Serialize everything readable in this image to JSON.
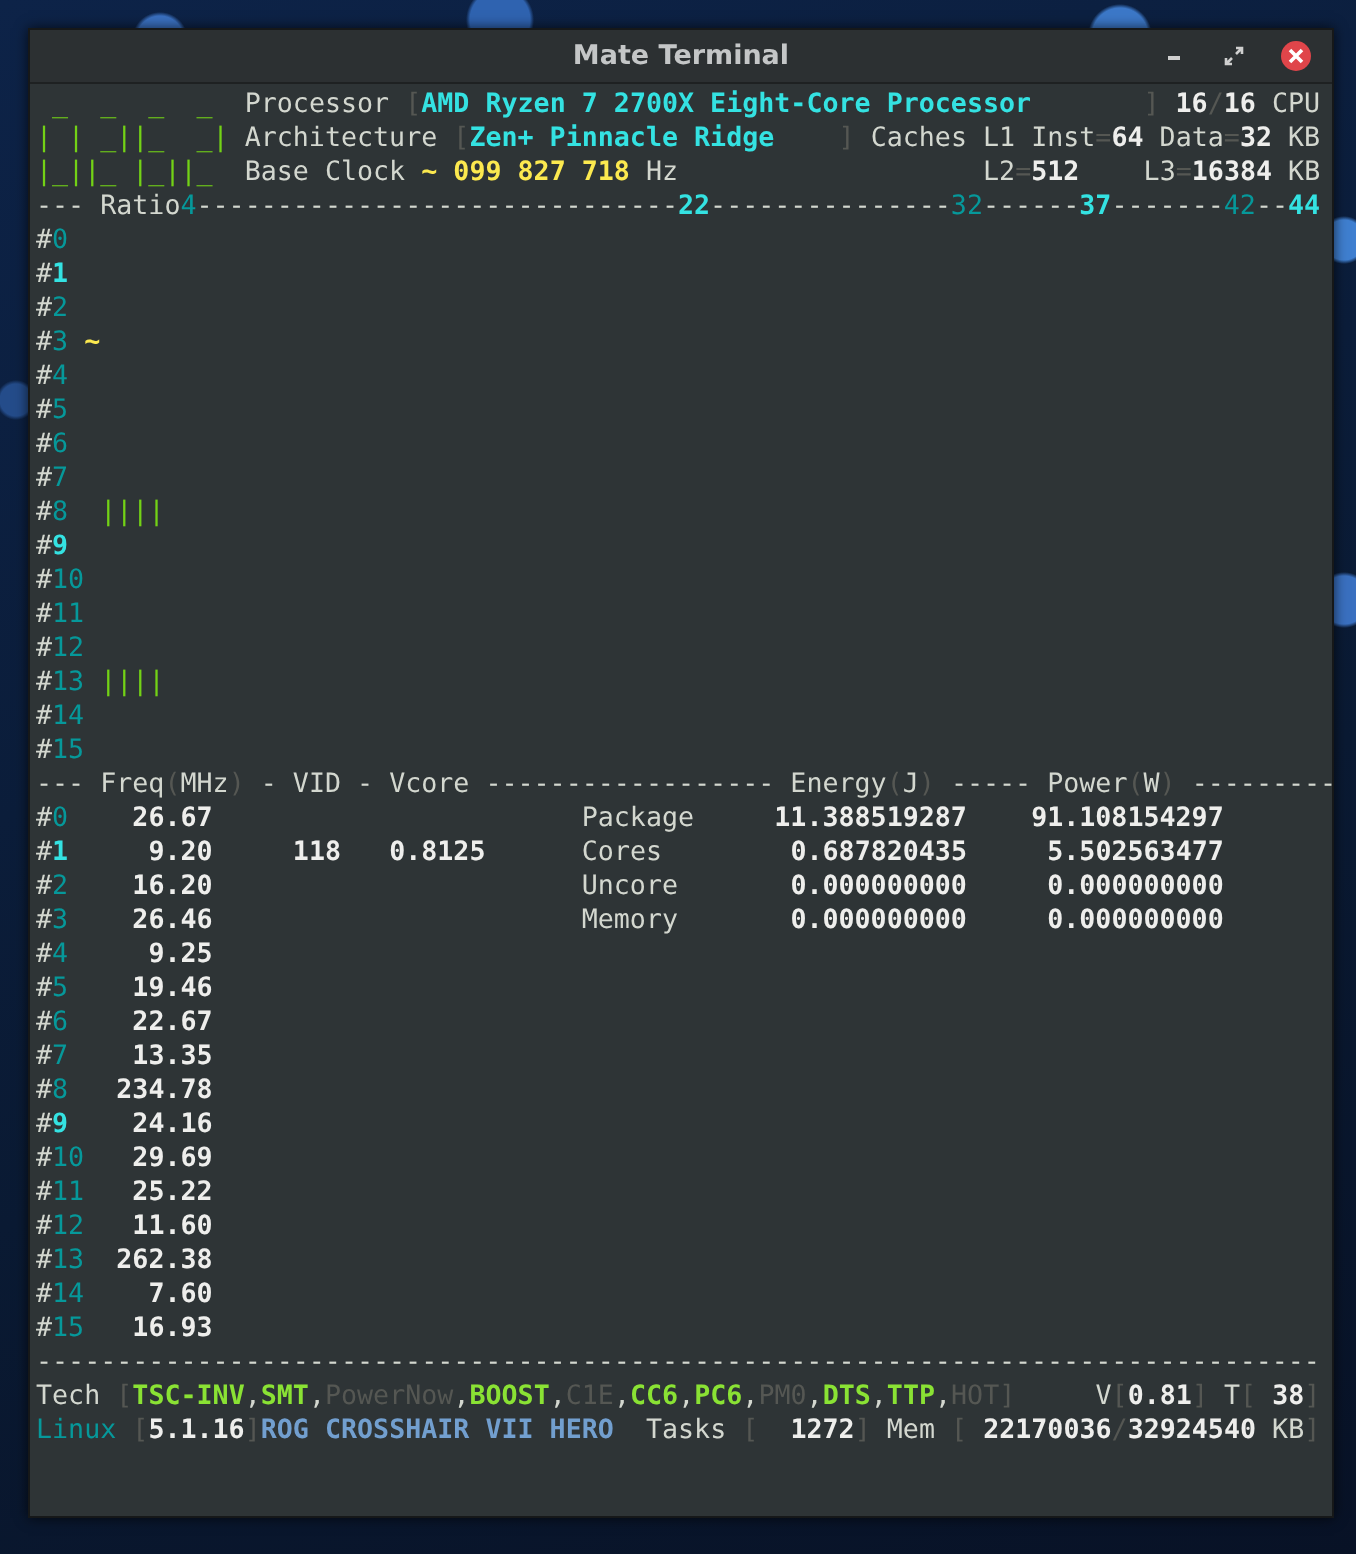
{
  "window": {
    "title": "Mate Terminal"
  },
  "terminal": {
    "lines": [
      {
        "segments": [
          {
            "text": " _  _  _  _  ",
            "kind": "graph"
          },
          {
            "text": "Processor ",
            "kind": "label"
          },
          {
            "text": "[",
            "kind": "muted"
          },
          {
            "text": "AMD Ryzen 7 2700X Eight-Core Processor",
            "kind": "highlight"
          },
          {
            "text": "       ] ",
            "kind": "muted"
          },
          {
            "text": "16",
            "kind": "value"
          },
          {
            "text": "/",
            "kind": "muted"
          },
          {
            "text": "16",
            "kind": "value"
          },
          {
            "text": " CPU",
            "kind": "label"
          }
        ]
      },
      {
        "segments": [
          {
            "text": "| | _||_  _| ",
            "kind": "graph"
          },
          {
            "text": "Architecture ",
            "kind": "label"
          },
          {
            "text": "[",
            "kind": "muted"
          },
          {
            "text": "Zen+ Pinnacle Ridge",
            "kind": "highlight"
          },
          {
            "text": "    ] ",
            "kind": "muted"
          },
          {
            "text": "Caches L1 Inst",
            "kind": "label"
          },
          {
            "text": "=",
            "kind": "muted"
          },
          {
            "text": "64",
            "kind": "value"
          },
          {
            "text": " Data",
            "kind": "label"
          },
          {
            "text": "=",
            "kind": "muted"
          },
          {
            "text": "32",
            "kind": "value"
          },
          {
            "text": " KB",
            "kind": "label"
          }
        ]
      },
      {
        "segments": [
          {
            "text": "|_||_ |_||_  ",
            "kind": "graph"
          },
          {
            "text": "Base Clock ",
            "kind": "label"
          },
          {
            "text": "~ 099 827 718",
            "kind": "clock"
          },
          {
            "text": " Hz",
            "kind": "label"
          },
          {
            "text": "                   L2",
            "kind": "label"
          },
          {
            "text": "=",
            "kind": "muted"
          },
          {
            "text": "512",
            "kind": "value"
          },
          {
            "text": "    L3",
            "kind": "label"
          },
          {
            "text": "=",
            "kind": "muted"
          },
          {
            "text": "16384",
            "kind": "value"
          },
          {
            "text": " KB",
            "kind": "label"
          }
        ]
      },
      {
        "segments": [
          {
            "text": "--- Ratio",
            "kind": "label"
          },
          {
            "text": "4",
            "kind": "index"
          },
          {
            "text": "------------------------------",
            "kind": "label"
          },
          {
            "text": "22",
            "kind": "highlight"
          },
          {
            "text": "---------------",
            "kind": "label"
          },
          {
            "text": "32",
            "kind": "index"
          },
          {
            "text": "------",
            "kind": "label"
          },
          {
            "text": "37",
            "kind": "highlight"
          },
          {
            "text": "-------",
            "kind": "label"
          },
          {
            "text": "42",
            "kind": "index"
          },
          {
            "text": "--",
            "kind": "label"
          },
          {
            "text": "44",
            "kind": "highlight"
          }
        ]
      },
      {
        "segments": [
          {
            "text": "#",
            "kind": "label"
          },
          {
            "text": "0",
            "kind": "index"
          }
        ]
      },
      {
        "segments": [
          {
            "text": "#",
            "kind": "label"
          },
          {
            "text": "1",
            "kind": "highlight"
          }
        ]
      },
      {
        "segments": [
          {
            "text": "#",
            "kind": "label"
          },
          {
            "text": "2",
            "kind": "index"
          }
        ]
      },
      {
        "segments": [
          {
            "text": "#",
            "kind": "label"
          },
          {
            "text": "3",
            "kind": "index"
          },
          {
            "text": " ~",
            "kind": "clock"
          }
        ]
      },
      {
        "segments": [
          {
            "text": "#",
            "kind": "label"
          },
          {
            "text": "4",
            "kind": "index"
          }
        ]
      },
      {
        "segments": [
          {
            "text": "#",
            "kind": "label"
          },
          {
            "text": "5",
            "kind": "index"
          }
        ]
      },
      {
        "segments": [
          {
            "text": "#",
            "kind": "label"
          },
          {
            "text": "6",
            "kind": "index"
          }
        ]
      },
      {
        "segments": [
          {
            "text": "#",
            "kind": "label"
          },
          {
            "text": "7",
            "kind": "index"
          }
        ]
      },
      {
        "segments": [
          {
            "text": "#",
            "kind": "label"
          },
          {
            "text": "8",
            "kind": "index"
          },
          {
            "text": "  ||||",
            "kind": "graph"
          }
        ]
      },
      {
        "segments": [
          {
            "text": "#",
            "kind": "label"
          },
          {
            "text": "9",
            "kind": "highlight"
          }
        ]
      },
      {
        "segments": [
          {
            "text": "#",
            "kind": "label"
          },
          {
            "text": "10",
            "kind": "index"
          }
        ]
      },
      {
        "segments": [
          {
            "text": "#",
            "kind": "label"
          },
          {
            "text": "11",
            "kind": "index"
          }
        ]
      },
      {
        "segments": [
          {
            "text": "#",
            "kind": "label"
          },
          {
            "text": "12",
            "kind": "index"
          }
        ]
      },
      {
        "segments": [
          {
            "text": "#",
            "kind": "label"
          },
          {
            "text": "13",
            "kind": "index"
          },
          {
            "text": " ||||",
            "kind": "graph"
          }
        ]
      },
      {
        "segments": [
          {
            "text": "#",
            "kind": "label"
          },
          {
            "text": "14",
            "kind": "index"
          }
        ]
      },
      {
        "segments": [
          {
            "text": "#",
            "kind": "label"
          },
          {
            "text": "15",
            "kind": "index"
          }
        ]
      },
      {
        "segments": [
          {
            "text": "--- Freq",
            "kind": "label"
          },
          {
            "text": "(",
            "kind": "muted"
          },
          {
            "text": "MHz",
            "kind": "label"
          },
          {
            "text": ")",
            "kind": "muted"
          },
          {
            "text": " - VID - Vcore ------------------ Energy",
            "kind": "label"
          },
          {
            "text": "(",
            "kind": "muted"
          },
          {
            "text": "J",
            "kind": "label"
          },
          {
            "text": ")",
            "kind": "muted"
          },
          {
            "text": " ----- Power",
            "kind": "label"
          },
          {
            "text": "(",
            "kind": "muted"
          },
          {
            "text": "W",
            "kind": "label"
          },
          {
            "text": ")",
            "kind": "muted"
          },
          {
            "text": " ---------",
            "kind": "label"
          }
        ]
      },
      {
        "segments": [
          {
            "text": "#",
            "kind": "label"
          },
          {
            "text": "0",
            "kind": "index"
          },
          {
            "text": "    26.67",
            "kind": "value"
          },
          {
            "text": "                       Package",
            "kind": "label"
          },
          {
            "text": "     11.388519287",
            "kind": "value"
          },
          {
            "text": "    91.108154297",
            "kind": "value"
          }
        ]
      },
      {
        "segments": [
          {
            "text": "#",
            "kind": "label"
          },
          {
            "text": "1",
            "kind": "highlight"
          },
          {
            "text": "     9.20",
            "kind": "value"
          },
          {
            "text": "     118",
            "kind": "value"
          },
          {
            "text": "   0.8125",
            "kind": "value"
          },
          {
            "text": "      Cores",
            "kind": "label"
          },
          {
            "text": "        0.687820435",
            "kind": "value"
          },
          {
            "text": "     5.502563477",
            "kind": "value"
          }
        ]
      },
      {
        "segments": [
          {
            "text": "#",
            "kind": "label"
          },
          {
            "text": "2",
            "kind": "index"
          },
          {
            "text": "    16.20",
            "kind": "value"
          },
          {
            "text": "                       Uncore",
            "kind": "label"
          },
          {
            "text": "       0.000000000",
            "kind": "value"
          },
          {
            "text": "     0.000000000",
            "kind": "value"
          }
        ]
      },
      {
        "segments": [
          {
            "text": "#",
            "kind": "label"
          },
          {
            "text": "3",
            "kind": "index"
          },
          {
            "text": "    26.46",
            "kind": "value"
          },
          {
            "text": "                       Memory",
            "kind": "label"
          },
          {
            "text": "       0.000000000",
            "kind": "value"
          },
          {
            "text": "     0.000000000",
            "kind": "value"
          }
        ]
      },
      {
        "segments": [
          {
            "text": "#",
            "kind": "label"
          },
          {
            "text": "4",
            "kind": "index"
          },
          {
            "text": "     9.25",
            "kind": "value"
          }
        ]
      },
      {
        "segments": [
          {
            "text": "#",
            "kind": "label"
          },
          {
            "text": "5",
            "kind": "index"
          },
          {
            "text": "    19.46",
            "kind": "value"
          }
        ]
      },
      {
        "segments": [
          {
            "text": "#",
            "kind": "label"
          },
          {
            "text": "6",
            "kind": "index"
          },
          {
            "text": "    22.67",
            "kind": "value"
          }
        ]
      },
      {
        "segments": [
          {
            "text": "#",
            "kind": "label"
          },
          {
            "text": "7",
            "kind": "index"
          },
          {
            "text": "    13.35",
            "kind": "value"
          }
        ]
      },
      {
        "segments": [
          {
            "text": "#",
            "kind": "label"
          },
          {
            "text": "8",
            "kind": "index"
          },
          {
            "text": "   234.78",
            "kind": "value"
          }
        ]
      },
      {
        "segments": [
          {
            "text": "#",
            "kind": "label"
          },
          {
            "text": "9",
            "kind": "highlight"
          },
          {
            "text": "    24.16",
            "kind": "value"
          }
        ]
      },
      {
        "segments": [
          {
            "text": "#",
            "kind": "label"
          },
          {
            "text": "10",
            "kind": "index"
          },
          {
            "text": "   29.69",
            "kind": "value"
          }
        ]
      },
      {
        "segments": [
          {
            "text": "#",
            "kind": "label"
          },
          {
            "text": "11",
            "kind": "index"
          },
          {
            "text": "   25.22",
            "kind": "value"
          }
        ]
      },
      {
        "segments": [
          {
            "text": "#",
            "kind": "label"
          },
          {
            "text": "12",
            "kind": "index"
          },
          {
            "text": "   11.60",
            "kind": "value"
          }
        ]
      },
      {
        "segments": [
          {
            "text": "#",
            "kind": "label"
          },
          {
            "text": "13",
            "kind": "index"
          },
          {
            "text": "  262.38",
            "kind": "value"
          }
        ]
      },
      {
        "segments": [
          {
            "text": "#",
            "kind": "label"
          },
          {
            "text": "14",
            "kind": "index"
          },
          {
            "text": "    7.60",
            "kind": "value"
          }
        ]
      },
      {
        "segments": [
          {
            "text": "#",
            "kind": "label"
          },
          {
            "text": "15",
            "kind": "index"
          },
          {
            "text": "   16.93",
            "kind": "value"
          }
        ]
      },
      {
        "segments": [
          {
            "text": "--------------------------------------------------------------------------------",
            "kind": "label"
          }
        ]
      },
      {
        "segments": [
          {
            "text": "Tech ",
            "kind": "label"
          },
          {
            "text": "[",
            "kind": "muted"
          },
          {
            "text": "TSC-INV",
            "kind": "enabled"
          },
          {
            "text": ",",
            "kind": "label"
          },
          {
            "text": "SMT",
            "kind": "enabled"
          },
          {
            "text": ",",
            "kind": "label"
          },
          {
            "text": "PowerNow",
            "kind": "muted"
          },
          {
            "text": ",",
            "kind": "label"
          },
          {
            "text": "BOOST",
            "kind": "enabled"
          },
          {
            "text": ",",
            "kind": "label"
          },
          {
            "text": "C1E",
            "kind": "muted"
          },
          {
            "text": ",",
            "kind": "label"
          },
          {
            "text": "CC6",
            "kind": "enabled"
          },
          {
            "text": ",",
            "kind": "label"
          },
          {
            "text": "PC6",
            "kind": "enabled"
          },
          {
            "text": ",",
            "kind": "label"
          },
          {
            "text": "PM0",
            "kind": "muted"
          },
          {
            "text": ",",
            "kind": "label"
          },
          {
            "text": "DTS",
            "kind": "enabled"
          },
          {
            "text": ",",
            "kind": "label"
          },
          {
            "text": "TTP",
            "kind": "enabled"
          },
          {
            "text": ",",
            "kind": "label"
          },
          {
            "text": "HOT",
            "kind": "muted"
          },
          {
            "text": "]",
            "kind": "muted"
          },
          {
            "text": "     V",
            "kind": "label"
          },
          {
            "text": "[",
            "kind": "muted"
          },
          {
            "text": "0.81",
            "kind": "value"
          },
          {
            "text": "]",
            "kind": "muted"
          },
          {
            "text": " T",
            "kind": "label"
          },
          {
            "text": "[ ",
            "kind": "muted"
          },
          {
            "text": "38",
            "kind": "value"
          },
          {
            "text": "]",
            "kind": "muted"
          }
        ]
      },
      {
        "segments": [
          {
            "text": "Linux",
            "kind": "index"
          },
          {
            "text": " [",
            "kind": "muted"
          },
          {
            "text": "5.1.16",
            "kind": "value"
          },
          {
            "text": "]",
            "kind": "muted"
          },
          {
            "text": "ROG CROSSHAIR VII HERO",
            "kind": "board"
          },
          {
            "text": "  Tasks ",
            "kind": "label"
          },
          {
            "text": "[  ",
            "kind": "muted"
          },
          {
            "text": "1272",
            "kind": "value"
          },
          {
            "text": "]",
            "kind": "muted"
          },
          {
            "text": " Mem ",
            "kind": "label"
          },
          {
            "text": "[ ",
            "kind": "muted"
          },
          {
            "text": "22170036",
            "kind": "value"
          },
          {
            "text": "/",
            "kind": "muted"
          },
          {
            "text": "32924540",
            "kind": "value"
          },
          {
            "text": " KB",
            "kind": "label"
          },
          {
            "text": "]",
            "kind": "muted"
          }
        ]
      }
    ]
  }
}
